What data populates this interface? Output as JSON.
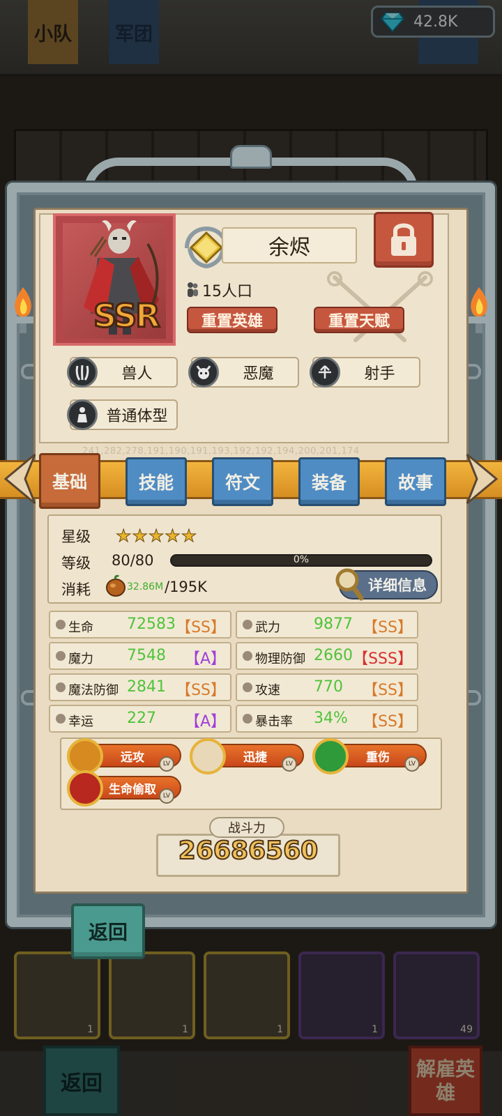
{
  "top_tabs": [
    "小队",
    "军团"
  ],
  "currency": {
    "icon": "diamond-icon",
    "value": "42.8K"
  },
  "hero": {
    "name": "余烬",
    "rarity": "SSR",
    "population": "15人口",
    "reset_hero": "重置英雄",
    "reset_talent": "重置天赋",
    "traits": [
      "兽人",
      "恶魔",
      "射手",
      "普通体型"
    ],
    "id_numbers": "241,282,278,191,190,191,193,192,192,194,200,201,174"
  },
  "tabs": [
    {
      "label": "基础",
      "active": true
    },
    {
      "label": "技能",
      "active": false
    },
    {
      "label": "符文",
      "active": false
    },
    {
      "label": "装备",
      "active": false
    },
    {
      "label": "故事",
      "active": false
    }
  ],
  "basic": {
    "star_label": "星级",
    "stars": 5,
    "level_label": "等级",
    "level": "80/80",
    "level_progress": "0%",
    "cost_label": "消耗",
    "cost_have": "32.86M",
    "cost_need": "/195K",
    "detail_button": "详细信息"
  },
  "stats": [
    {
      "name": "生命",
      "value": "72583",
      "grade": "【SS】",
      "grade_color": "#d77a2a",
      "icon": "heart-icon"
    },
    {
      "name": "武力",
      "value": "9877",
      "grade": "【SS】",
      "grade_color": "#d77a2a",
      "icon": "sword-icon"
    },
    {
      "name": "魔力",
      "value": "7548",
      "grade": "【A】",
      "grade_color": "#a040d8",
      "icon": "sparkle-icon"
    },
    {
      "name": "物理防御",
      "value": "2660",
      "grade": "【SSS】",
      "grade_color": "#d83030",
      "icon": "shield-icon"
    },
    {
      "name": "魔法防御",
      "value": "2841",
      "grade": "【SS】",
      "grade_color": "#d77a2a",
      "icon": "magic-shield-icon"
    },
    {
      "name": "攻速",
      "value": "770",
      "grade": "【SS】",
      "grade_color": "#d77a2a",
      "icon": "wing-icon"
    },
    {
      "name": "幸运",
      "value": "227",
      "grade": "【A】",
      "grade_color": "#a040d8",
      "icon": "clover-icon"
    },
    {
      "name": "暴击率",
      "value": "34%",
      "grade": "【SS】",
      "grade_color": "#d77a2a",
      "icon": "burst-icon"
    }
  ],
  "skills": [
    "远攻",
    "迅捷",
    "重伤",
    "生命偷取"
  ],
  "power": {
    "label": "战斗力",
    "value": "26686560"
  },
  "back_button": "返回",
  "background": {
    "back_button": "返回",
    "dismiss_button": "解雇英雄",
    "card_numbers": [
      "1",
      "1",
      "1",
      "1",
      "49"
    ]
  }
}
